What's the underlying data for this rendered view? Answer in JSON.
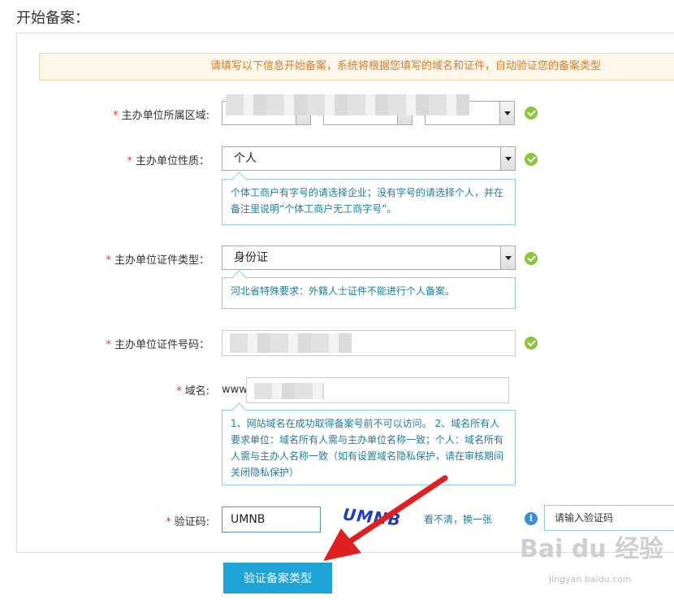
{
  "page": {
    "title": "开始备案："
  },
  "notice": {
    "text": "请填写以下信息开始备案，系统将根据您填写的域名和证件，自动验证您的备案类型"
  },
  "form": {
    "required_mark": "*",
    "region": {
      "label": "主办单位所属区域:"
    },
    "nature": {
      "label": "主办单位性质：",
      "value": "个人",
      "tip": "个体工商户有字号的请选择企业；没有字号的请选择个人，并在备注里说明“个体工商户无工商字号”。"
    },
    "cert_type": {
      "label": "主办单位证件类型：",
      "value": "身份证",
      "tip": "河北省特殊要求：外籍人士证件不能进行个人备案。"
    },
    "cert_number": {
      "label": "主办单位证件号码："
    },
    "domain": {
      "label": "域名:",
      "prefix": "www.",
      "tip": "1、网站域名在成功取得备案号前不可以访问。 2、域名所有人要求单位：域名所有人需与主办单位名称一致；个人：域名所有人需与主办人名称一致（如有设置域名隐私保护，请在审核期间关闭隐私保护）"
    },
    "captcha": {
      "label": "验证码:",
      "value": "UMNB",
      "image_text": "UMNB",
      "refresh_label": "看不清，换一张",
      "info_icon": "i",
      "hint": "请输入验证码"
    },
    "submit_label": "验证备案类型"
  },
  "watermark": {
    "text": "Bai du 经验",
    "sub": "jingyan.baidu.com"
  },
  "colors": {
    "accent": "#1fa2d5",
    "success": "#8cc43a",
    "notice": "#e07a2a",
    "required": "#e33333",
    "annotation": "#e02020"
  }
}
